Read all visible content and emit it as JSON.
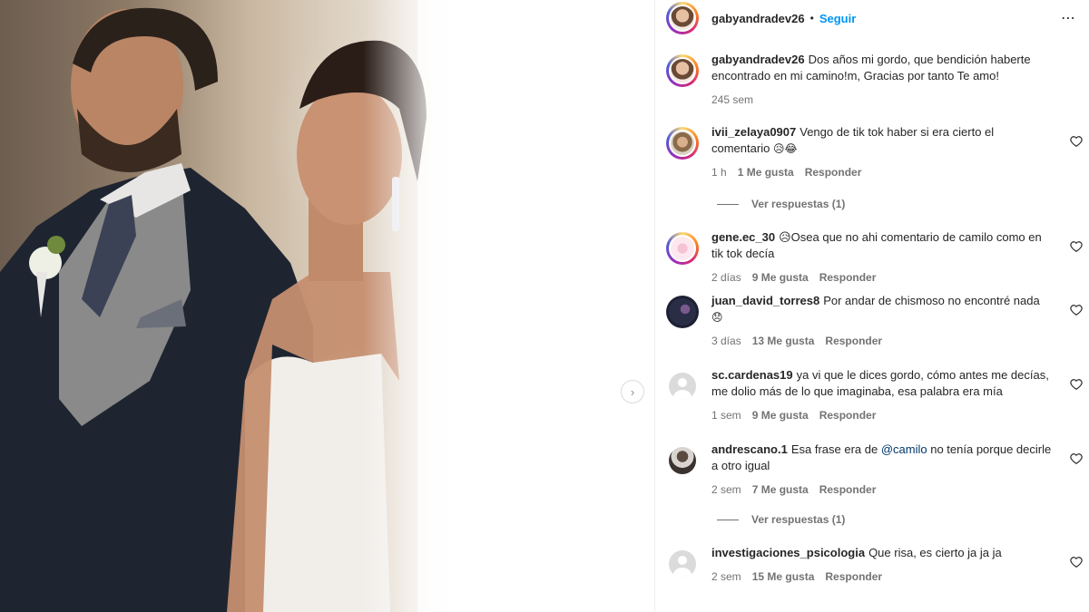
{
  "post": {
    "author": "gabyandradev26",
    "follow_label": "Seguir",
    "dot": "•",
    "more_icon": "⋯",
    "caption": "Dos años mi gordo, que bendición haberte encontrado en mi camino!m, Gracias por tanto Te amo!",
    "caption_time": "245 sem"
  },
  "media": {
    "next_icon": "›",
    "description_icon": "wedding-photo"
  },
  "comments": [
    {
      "user": "ivii_zelaya0907",
      "text": "Vengo de tik tok haber si era cierto el comentario",
      "emoji": "😥😂",
      "time": "1 h",
      "likes": "1 Me gusta",
      "reply": "Responder",
      "view_replies": "Ver respuestas (1)"
    },
    {
      "user": "gene.ec_30",
      "text": "😥Osea que no ahi comentario de camilo como en tik tok decía",
      "emoji": "",
      "time": "2 días",
      "likes": "9 Me gusta",
      "reply": "Responder"
    },
    {
      "user": "juan_david_torres8",
      "text": "Por andar de chismoso no encontré nada",
      "emoji": "😞",
      "time": "3 días",
      "likes": "13 Me gusta",
      "reply": "Responder"
    },
    {
      "user": "sc.cardenas19",
      "text": "ya vi que le dices gordo, cómo antes me decías, me dolio más de lo que imaginaba, esa palabra era mía",
      "emoji": "",
      "time": "1 sem",
      "likes": "9 Me gusta",
      "reply": "Responder"
    },
    {
      "user": "andrescano.1",
      "text_before": "Esa frase era de",
      "mention": "@camilo",
      "text_after": "no tenía porque decirle a otro igual",
      "time": "2 sem",
      "likes": "7 Me gusta",
      "reply": "Responder",
      "view_replies": "Ver respuestas (1)"
    },
    {
      "user": "investigaciones_psicologia",
      "text": "Que risa, es cierto ja ja ja",
      "emoji": "",
      "time": "2 sem",
      "likes": "15 Me gusta",
      "reply": "Responder"
    }
  ],
  "icons": {
    "heart": "heart-icon"
  },
  "colors": {
    "link": "#0095f6",
    "secondary_text": "#737373",
    "primary_text": "#262626",
    "mention": "#00376b"
  }
}
